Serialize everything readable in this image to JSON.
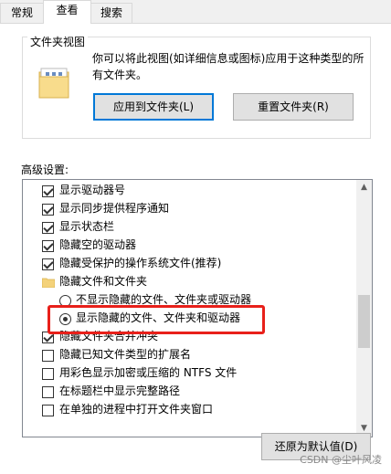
{
  "tabs": [
    {
      "label": "常规"
    },
    {
      "label": "查看"
    },
    {
      "label": "搜索"
    }
  ],
  "folder_views": {
    "title": "文件夹视图",
    "description": "你可以将此视图(如详细信息或图标)应用于这种类型的所有文件夹。",
    "apply_button": "应用到文件夹(L)",
    "reset_button": "重置文件夹(R)"
  },
  "advanced": {
    "label": "高级设置:",
    "items": [
      {
        "label": "显示驱动器号",
        "kind": "checkbox",
        "checked": true
      },
      {
        "label": "显示同步提供程序通知",
        "kind": "checkbox",
        "checked": true
      },
      {
        "label": "显示状态栏",
        "kind": "checkbox",
        "checked": true
      },
      {
        "label": "隐藏空的驱动器",
        "kind": "checkbox",
        "checked": true
      },
      {
        "label": "隐藏受保护的操作系统文件(推荐)",
        "kind": "checkbox",
        "checked": true
      },
      {
        "label": "隐藏文件和文件夹",
        "kind": "folder"
      },
      {
        "label": "不显示隐藏的文件、文件夹或驱动器",
        "kind": "radio",
        "checked": false
      },
      {
        "label": "显示隐藏的文件、文件夹和驱动器",
        "kind": "radio",
        "checked": true
      },
      {
        "label": "隐藏文件夹合并冲突",
        "kind": "checkbox",
        "checked": true
      },
      {
        "label": "隐藏已知文件类型的扩展名",
        "kind": "checkbox",
        "checked": false
      },
      {
        "label": "用彩色显示加密或压缩的 NTFS 文件",
        "kind": "checkbox",
        "checked": false
      },
      {
        "label": "在标题栏中显示完整路径",
        "kind": "checkbox",
        "checked": false
      },
      {
        "label": "在单独的进程中打开文件夹窗口",
        "kind": "checkbox",
        "checked": false
      }
    ]
  },
  "restore_button": "还原为默认值(D)",
  "watermark": "CSDN @尘叶风凌",
  "colors": {
    "highlight": "#e8201a",
    "focus": "#0078d7"
  }
}
